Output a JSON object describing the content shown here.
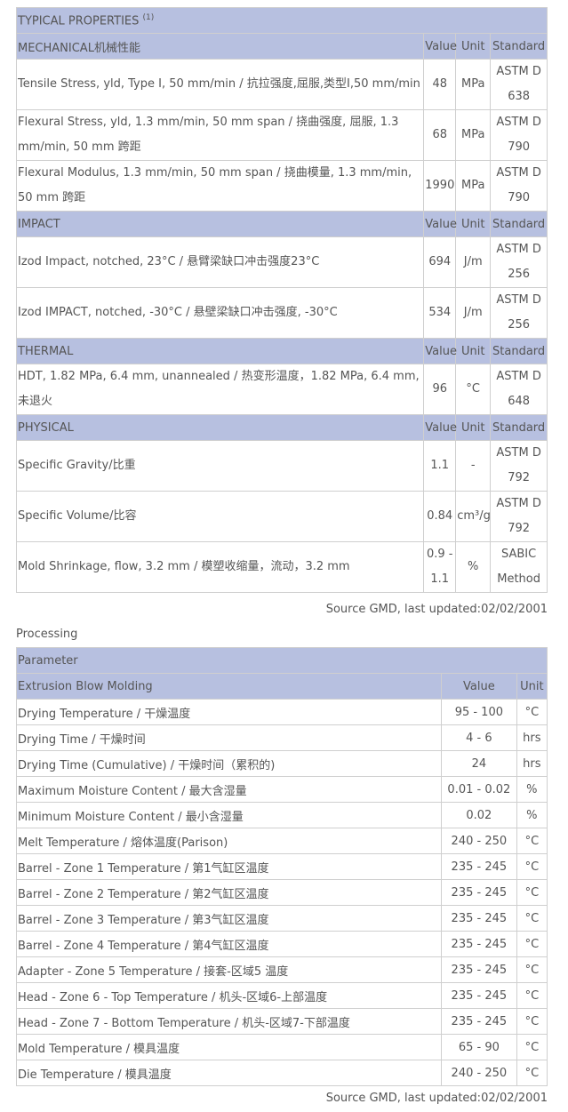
{
  "properties": {
    "title": "TYPICAL PROPERTIES",
    "title_note": "(1)",
    "sections": [
      {
        "name": "MECHANICAL机械性能",
        "header": {
          "value": "Value",
          "unit": "Unit",
          "standard": "Standard"
        },
        "rows": [
          {
            "desc": "Tensile Stress, yld, Type I, 50 mm/min / 抗拉强度,屈服,类型I,50 mm/min",
            "value": "48",
            "unit": "MPa",
            "std": "ASTM D 638"
          },
          {
            "desc": "Flexural Stress, yld, 1.3 mm/min, 50 mm span / 挠曲强度, 屈服, 1.3 mm/min, 50 mm 跨距",
            "value": "68",
            "unit": "MPa",
            "std": "ASTM D 790"
          },
          {
            "desc": "Flexural Modulus, 1.3 mm/min, 50 mm span / 挠曲模量, 1.3 mm/min, 50 mm 跨距",
            "value": "1990",
            "unit": "MPa",
            "std": "ASTM D 790"
          }
        ]
      },
      {
        "name": "IMPACT",
        "header": {
          "value": "Value",
          "unit": "Unit",
          "standard": "Standard"
        },
        "rows": [
          {
            "desc": "Izod Impact, notched, 23°C / 悬臂梁缺口冲击强度23°C",
            "value": "694",
            "unit": "J/m",
            "std": "ASTM D 256"
          },
          {
            "desc": "Izod IMPACT, notched, -30°C / 悬壁梁缺口冲击强度, -30°C",
            "value": "534",
            "unit": "J/m",
            "std": "ASTM D 256"
          }
        ]
      },
      {
        "name": "THERMAL",
        "header": {
          "value": "Value",
          "unit": "Unit",
          "standard": "Standard"
        },
        "rows": [
          {
            "desc": "HDT, 1.82 MPa, 6.4 mm, unannealed / 热变形温度，1.82 MPa, 6.4 mm, 未退火",
            "value": "96",
            "unit": "°C",
            "std": "ASTM D 648"
          }
        ]
      },
      {
        "name": "PHYSICAL",
        "header": {
          "value": "Value",
          "unit": "Unit",
          "standard": "Standard"
        },
        "rows": [
          {
            "desc": "Specific Gravity/比重",
            "value": "1.1",
            "unit": "-",
            "std": "ASTM D 792"
          },
          {
            "desc": "Specific Volume/比容",
            "value": "0.84",
            "unit": "cm³/g",
            "std": "ASTM D 792"
          },
          {
            "desc": "Mold Shrinkage, flow, 3.2 mm / 模塑收缩量，流动，3.2 mm",
            "value": "0.9 - 1.1",
            "unit": "%",
            "std": "SABIC Method"
          }
        ]
      }
    ],
    "source": "Source GMD, last updated:02/02/2001"
  },
  "processing": {
    "title": "Processing",
    "param_header": "Parameter",
    "section": {
      "name": "Extrusion Blow Molding",
      "value": "Value",
      "unit": "Unit"
    },
    "rows": [
      {
        "param": "Drying Temperature / 干燥温度",
        "value": "95 - 100",
        "unit": "°C"
      },
      {
        "param": "Drying Time / 干燥时间",
        "value": "4 - 6",
        "unit": "hrs"
      },
      {
        "param": "Drying Time (Cumulative) / 干燥时间（累积的)",
        "value": "24",
        "unit": "hrs"
      },
      {
        "param": "Maximum Moisture Content / 最大含湿量",
        "value": "0.01 - 0.02",
        "unit": "%"
      },
      {
        "param": "Minimum Moisture Content / 最小含湿量",
        "value": "0.02",
        "unit": "%"
      },
      {
        "param": "Melt Temperature / 熔体温度(Parison)",
        "value": "240 - 250",
        "unit": "°C"
      },
      {
        "param": "Barrel - Zone 1 Temperature / 第1气缸区温度",
        "value": "235 - 245",
        "unit": "°C"
      },
      {
        "param": "Barrel - Zone 2 Temperature / 第2气缸区温度",
        "value": "235 - 245",
        "unit": "°C"
      },
      {
        "param": "Barrel - Zone 3 Temperature / 第3气缸区温度",
        "value": "235 - 245",
        "unit": "°C"
      },
      {
        "param": "Barrel - Zone 4 Temperature / 第4气缸区温度",
        "value": "235 - 245",
        "unit": "°C"
      },
      {
        "param": "Adapter - Zone 5 Temperature / 接套-区域5 温度",
        "value": "235 - 245",
        "unit": "°C"
      },
      {
        "param": "Head - Zone 6 - Top Temperature / 机头-区域6-上部温度",
        "value": "235 - 245",
        "unit": "°C"
      },
      {
        "param": "Head - Zone 7 - Bottom Temperature / 机头-区域7-下部温度",
        "value": "235 - 245",
        "unit": "°C"
      },
      {
        "param": "Mold Temperature / 模具温度",
        "value": "65 - 90",
        "unit": "°C"
      },
      {
        "param": "Die Temperature / 模具温度",
        "value": "240 - 250",
        "unit": "°C"
      }
    ],
    "source": "Source GMD, last updated:02/02/2001"
  }
}
